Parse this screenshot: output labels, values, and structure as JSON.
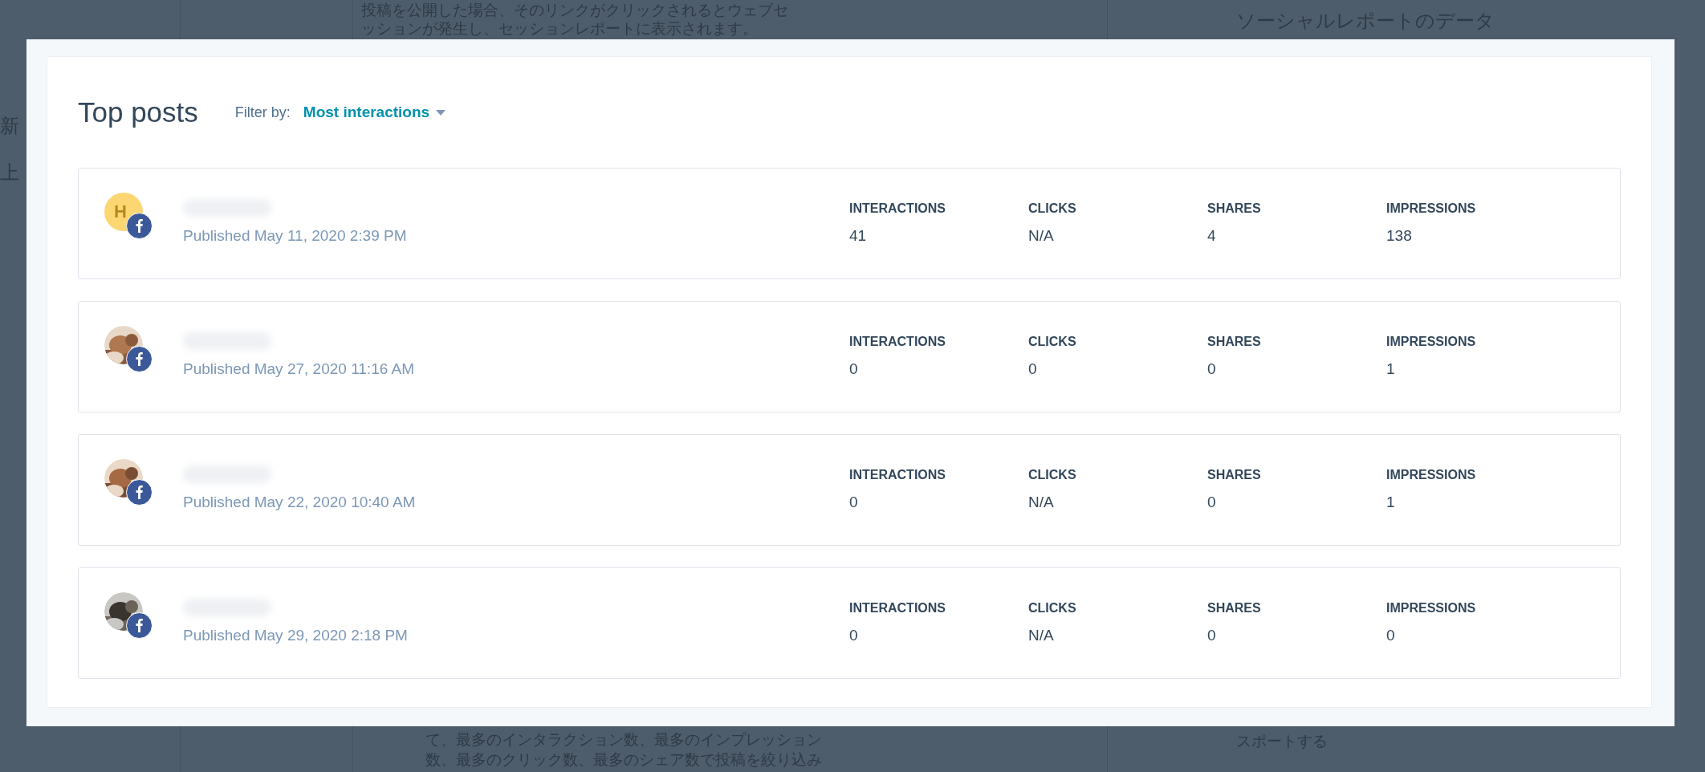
{
  "background": {
    "top_lines": [
      "投稿を公開した場合、そのリンクがクリックされるとウェブセ",
      "ッションが発生し、セッションレポートに表示されます。"
    ],
    "top_right": "ソーシャルレポートのデータ",
    "left_chars": [
      "新",
      "上"
    ],
    "bottom_lines": [
      "て、最多のインタラクション数、最多のインプレッション",
      "数、最多のクリック数、最多のシェア数で投稿を絞り込み"
    ],
    "bottom_right": "スポートする"
  },
  "modal": {
    "title": "Top posts",
    "filter_label": "Filter by:",
    "filter_value": "Most interactions",
    "posts": [
      {
        "avatar": {
          "kind": "initial",
          "text": "H"
        },
        "published": "Published May 11, 2020 2:39 PM",
        "stats": [
          {
            "label": "INTERACTIONS",
            "value": "41"
          },
          {
            "label": "CLICKS",
            "value": "N/A"
          },
          {
            "label": "SHARES",
            "value": "4"
          },
          {
            "label": "IMPRESSIONS",
            "value": "138"
          }
        ]
      },
      {
        "published": "Published May 27, 2020 11:16 AM",
        "stats": [
          {
            "label": "INTERACTIONS",
            "value": "0"
          },
          {
            "label": "CLICKS",
            "value": "0"
          },
          {
            "label": "SHARES",
            "value": "0"
          },
          {
            "label": "IMPRESSIONS",
            "value": "1"
          }
        ]
      },
      {
        "published": "Published May 22, 2020 10:40 AM",
        "stats": [
          {
            "label": "INTERACTIONS",
            "value": "0"
          },
          {
            "label": "CLICKS",
            "value": "N/A"
          },
          {
            "label": "SHARES",
            "value": "0"
          },
          {
            "label": "IMPRESSIONS",
            "value": "1"
          }
        ]
      },
      {
        "published": "Published May 29, 2020 2:18 PM",
        "stats": [
          {
            "label": "INTERACTIONS",
            "value": "0"
          },
          {
            "label": "CLICKS",
            "value": "N/A"
          },
          {
            "label": "SHARES",
            "value": "0"
          },
          {
            "label": "IMPRESSIONS",
            "value": "0"
          }
        ]
      }
    ]
  }
}
